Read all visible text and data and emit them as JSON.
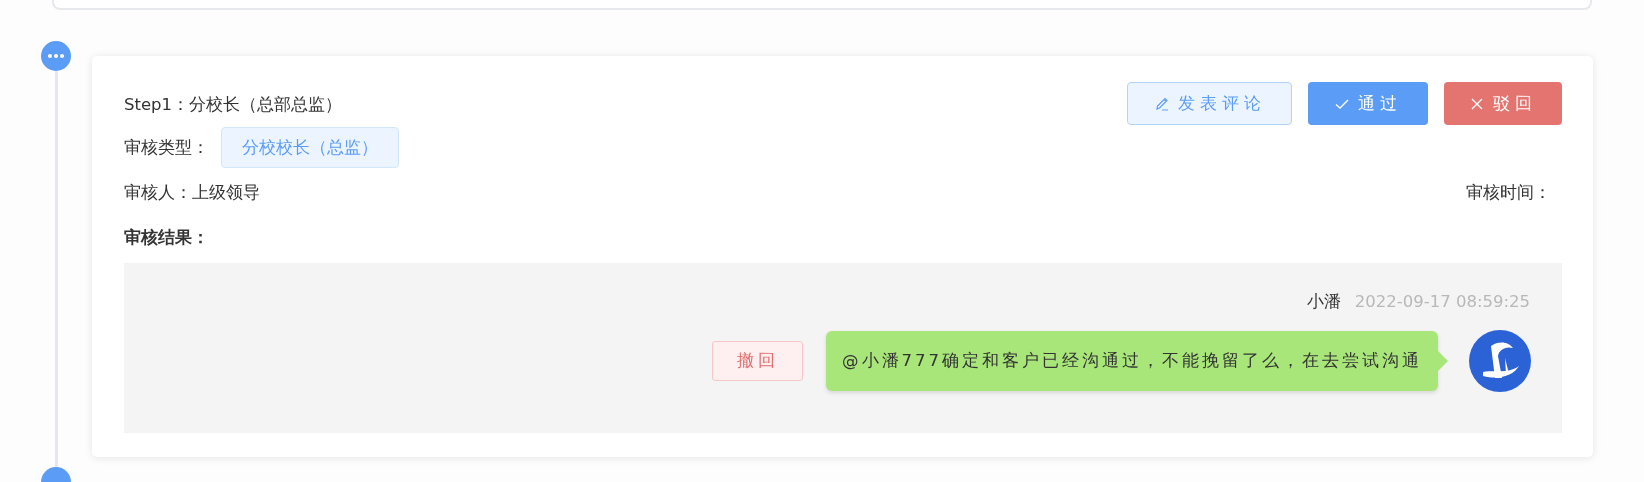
{
  "step": {
    "title": "Step1：分校长（总部总监）",
    "type_label": "审核类型：",
    "type_tag": "分校校长（总监）",
    "reviewer": "审核人：上级领导",
    "review_time_label": "审核时间：",
    "result_label": "审核结果："
  },
  "actions": [
    {
      "kind": "comment",
      "label": "发表评论"
    },
    {
      "kind": "approve",
      "label": "通过"
    },
    {
      "kind": "reject",
      "label": "驳回"
    }
  ],
  "comments": [
    {
      "author": "小潘",
      "time": "2022-09-17 08:59:25",
      "message": "@小潘777确定和客户已经沟通过，不能挽留了么，在去尝试沟通",
      "recall_label": "撤回"
    }
  ]
}
